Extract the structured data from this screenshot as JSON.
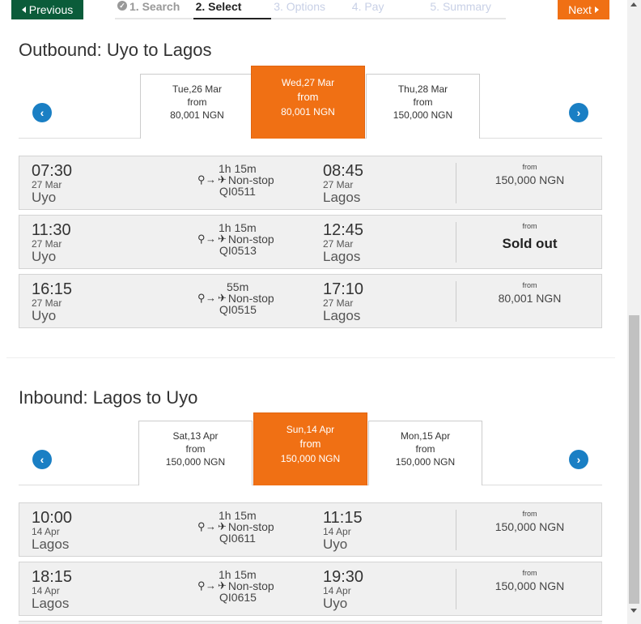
{
  "nav": {
    "previous_label": "Previous",
    "next_label": "Next",
    "steps": [
      {
        "label": "1. Search",
        "state": "done"
      },
      {
        "label": "2. Select",
        "state": "active"
      },
      {
        "label": "3. Options",
        "state": "future"
      },
      {
        "label": "4. Pay",
        "state": "future"
      },
      {
        "label": "5. Summary",
        "state": "future"
      }
    ]
  },
  "colors": {
    "accent_orange": "#f07014",
    "previous_green": "#0b5c3a",
    "arrow_blue": "#1a7fc4"
  },
  "outbound": {
    "heading": "Outbound: Uyo to Lagos",
    "days": [
      {
        "day": "Tue,26 Mar",
        "from": "from",
        "price": "80,001 NGN",
        "selected": false
      },
      {
        "day": "Wed,27 Mar",
        "from": "from",
        "price": "80,001 NGN",
        "selected": true
      },
      {
        "day": "Thu,28 Mar",
        "from": "from",
        "price": "150,000 NGN",
        "selected": false
      }
    ],
    "flights": [
      {
        "dep_time": "07:30",
        "dep_date": "27 Mar",
        "dep_city": "Uyo",
        "duration": "1h 15m",
        "stops": "Non-stop",
        "flight_no": "QI0511",
        "arr_time": "08:45",
        "arr_date": "27 Mar",
        "arr_city": "Lagos",
        "from": "from",
        "price": "150,000 NGN"
      },
      {
        "dep_time": "11:30",
        "dep_date": "27 Mar",
        "dep_city": "Uyo",
        "duration": "1h 15m",
        "stops": "Non-stop",
        "flight_no": "QI0513",
        "arr_time": "12:45",
        "arr_date": "27 Mar",
        "arr_city": "Lagos",
        "from": "from",
        "price": "Sold out"
      },
      {
        "dep_time": "16:15",
        "dep_date": "27 Mar",
        "dep_city": "Uyo",
        "duration": "55m",
        "stops": "Non-stop",
        "flight_no": "QI0515",
        "arr_time": "17:10",
        "arr_date": "27 Mar",
        "arr_city": "Lagos",
        "from": "from",
        "price": "80,001 NGN"
      }
    ]
  },
  "inbound": {
    "heading": "Inbound: Lagos to Uyo",
    "days": [
      {
        "day": "Sat,13 Apr",
        "from": "from",
        "price": "150,000 NGN",
        "selected": false
      },
      {
        "day": "Sun,14 Apr",
        "from": "from",
        "price": "150,000 NGN",
        "selected": true
      },
      {
        "day": "Mon,15 Apr",
        "from": "from",
        "price": "150,000 NGN",
        "selected": false
      }
    ],
    "flights": [
      {
        "dep_time": "10:00",
        "dep_date": "14 Apr",
        "dep_city": "Lagos",
        "duration": "1h 15m",
        "stops": "Non-stop",
        "flight_no": "QI0611",
        "arr_time": "11:15",
        "arr_date": "14 Apr",
        "arr_city": "Uyo",
        "from": "from",
        "price": "150,000 NGN"
      },
      {
        "dep_time": "18:15",
        "dep_date": "14 Apr",
        "dep_city": "Lagos",
        "duration": "1h 15m",
        "stops": "Non-stop",
        "flight_no": "QI0615",
        "arr_time": "19:30",
        "arr_date": "14 Apr",
        "arr_city": "Uyo",
        "from": "from",
        "price": "150,000 NGN"
      }
    ]
  }
}
